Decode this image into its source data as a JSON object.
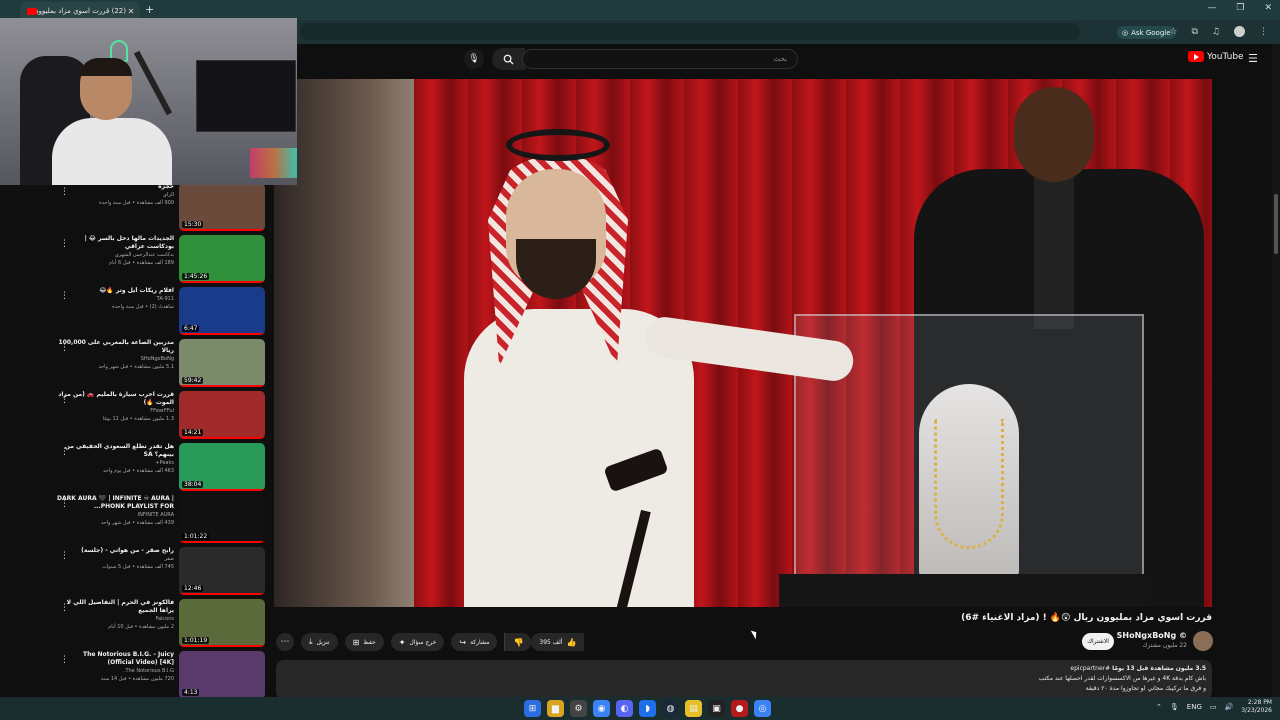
{
  "browser": {
    "tab_title": "(22) قررت اسوي مزاد بمليوون...",
    "ask_google": "Ask Google",
    "new_tab_icon": "plus-icon"
  },
  "youtube": {
    "search_placeholder": "بحث",
    "logo_text": "YouTube"
  },
  "video": {
    "title": "قررت اسوي مزاد بمليوون ريال 😲🔥 ! (مزاد الاغنياء #6)",
    "channel_name": "SHoNgxBoNg ©",
    "channel_subs": "22 مليون مشترك",
    "subscribe_label": "الاشتراك",
    "likes": "395 ألف",
    "share_label": "مشاركة",
    "ask_label": "خرج سؤال",
    "save_label": "حفظ",
    "download_label": "تنزيل",
    "desc_stats": "3.5 مليون مشاهدة قبل 13 يومًا",
    "desc_hashtag": "#epicpartner",
    "desc_line1": "باش كام بدفة 4K و غيرها من الاكسسوارات لقدر احصلها عند مكتب",
    "desc_line2": "و فرق ما تركيبك مجاني لو تجاوزوا مدة ٢٠ دقيقة"
  },
  "recommendations": [
    {
      "title": "حجزه",
      "channel": "الزاي",
      "meta": "900 ألف مشاهدة • قبل سنة واحدة",
      "duration": "15:30",
      "color": "#6a4a3b"
    },
    {
      "title": "الجديدات مالها دخل بالسر 😂 | بودكاست عراقي",
      "channel": "بدكاست عبدالرحمن الشهري",
      "meta": "189 ألف مشاهدة • قبل 6 أيام",
      "duration": "1:45:26",
      "color": "#2f8f3a"
    },
    {
      "title": "افلام ريكات أيل وتر 🔥😂",
      "channel": "TA-911",
      "meta": "شاهدتُ (2) • قبل سنة واحدة",
      "duration": "6:47",
      "color": "#1a3a8a"
    },
    {
      "title": "مدربين الصاعة بالمغربي على 100,000 ريالا",
      "channel": "SHoNgxBoNg",
      "meta": "5.1 مليون مشاهدة • قبل شهر واحد",
      "duration": "59:42",
      "color": "#7a8a6a"
    },
    {
      "title": "قررت اخرب سيارة بالمليم 🚗 (من مزاد الموت 🔥)",
      "channel": "FFearFFul",
      "meta": "1.3 مليون مشاهدة • قبل 11 يومًا",
      "duration": "14:21",
      "color": "#a02a2a"
    },
    {
      "title": "هل تقدر تطلع السعودي الحقيقي من بينهم؟ SA",
      "channel": "Peaks+",
      "meta": "463 ألف مشاهدة • قبل يوم واحد",
      "duration": "38:04",
      "color": "#2a9a5a"
    },
    {
      "title": "DARK AURA 🖤 | INFINITE ♾ AURA | PHONK PLAYLIST FOR...",
      "channel": "INFINITE AURA",
      "meta": "439 ألف مشاهدة • قبل شهر واحد",
      "duration": "1:01:22",
      "color": "#111111"
    },
    {
      "title": "رابح صقر - من هواتي - (جلسة)",
      "channel": "صقر",
      "meta": "745 ألف مشاهدة • قبل 5 سنوات",
      "duration": "12:46",
      "color": "#2a2a2a"
    },
    {
      "title": "فالكونز في الحرم | التفاصيل اللي لا يراها الجميع",
      "channel": "Falcons",
      "meta": "2 مليون مشاهدة • قبل 10 أيام",
      "duration": "1:01:19",
      "color": "#5a6a3a"
    },
    {
      "title": "The Notorious B.I.G. - Juicy (Official Video) [4K]",
      "channel": "The Notorious B.I.G.",
      "meta": "720 مليون مشاهدة • قبل 14 سنة",
      "duration": "4:13",
      "color": "#5a3a6a"
    }
  ],
  "taskbar": {
    "lang": "ENG",
    "time": "2:28 PM",
    "date": "3/23/2026"
  }
}
